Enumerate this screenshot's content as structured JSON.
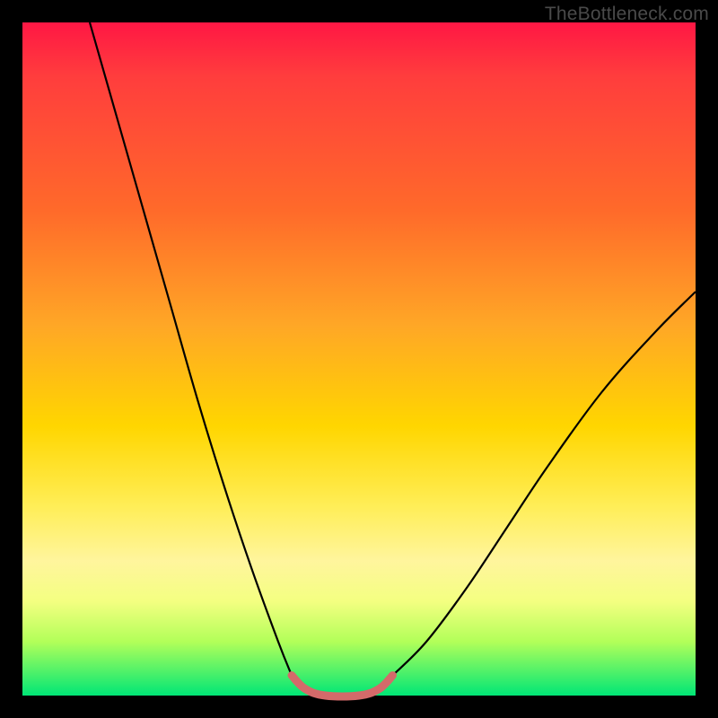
{
  "watermark": "TheBottleneck.com",
  "chart_data": {
    "type": "line",
    "title": "",
    "xlabel": "",
    "ylabel": "",
    "xlim": [
      0,
      100
    ],
    "ylim": [
      0,
      100
    ],
    "background_gradient": {
      "description": "Vertical red-to-green rainbow indicating bottleneck severity",
      "stops": [
        {
          "pos": 0,
          "color": "#ff1744"
        },
        {
          "pos": 28,
          "color": "#ff6a2a"
        },
        {
          "pos": 60,
          "color": "#ffd600"
        },
        {
          "pos": 86,
          "color": "#f4ff81"
        },
        {
          "pos": 100,
          "color": "#00e676"
        }
      ]
    },
    "series": [
      {
        "name": "left-curve",
        "stroke": "#000000",
        "stroke_width": 2.2,
        "x": [
          10,
          14,
          18,
          22,
          26,
          30,
          34,
          38,
          40
        ],
        "y": [
          100,
          86,
          72,
          58,
          44,
          31,
          19,
          8,
          3
        ]
      },
      {
        "name": "right-curve",
        "stroke": "#000000",
        "stroke_width": 2.2,
        "x": [
          55,
          60,
          66,
          72,
          78,
          86,
          94,
          100
        ],
        "y": [
          3,
          8,
          16,
          25,
          34,
          45,
          54,
          60
        ]
      },
      {
        "name": "valley-highlight",
        "stroke": "#d46a6a",
        "stroke_width": 9,
        "x": [
          40,
          42,
          45,
          50,
          53,
          55
        ],
        "y": [
          3,
          1,
          0,
          0,
          1,
          3
        ]
      }
    ]
  }
}
